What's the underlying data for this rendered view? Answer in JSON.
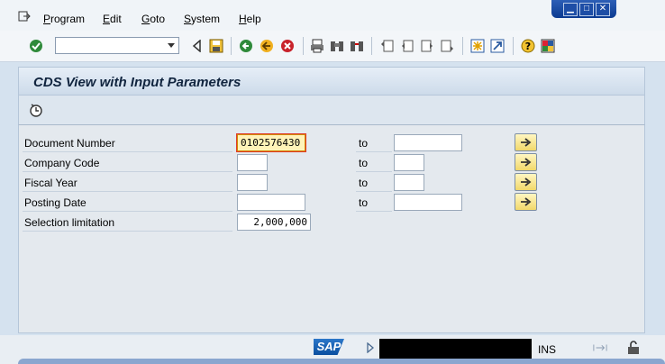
{
  "menu": {
    "items": [
      "Program",
      "Edit",
      "Goto",
      "System",
      "Help"
    ]
  },
  "toolbar": {
    "command_field_value": ""
  },
  "screen": {
    "title": "CDS View with Input Parameters"
  },
  "form": {
    "rows": [
      {
        "label": "Document Number",
        "low": "0102576430",
        "to_label": "to",
        "high": ""
      },
      {
        "label": "Company Code",
        "low": "",
        "to_label": "to",
        "high": ""
      },
      {
        "label": "Fiscal Year",
        "low": "",
        "to_label": "to",
        "high": ""
      },
      {
        "label": "Posting Date",
        "low": "",
        "to_label": "to",
        "high": ""
      },
      {
        "label": "Selection limitation",
        "low": "2,000,000"
      }
    ]
  },
  "statusbar": {
    "logo": "SAP",
    "mode": "INS"
  },
  "colors": {
    "background": "#d5e2ef",
    "focus_field": "#fff3b8",
    "accent": "#0b3a91"
  },
  "icons": [
    "menu-icon",
    "enter-icon",
    "back-nav-icon",
    "save-icon",
    "back-icon",
    "exit-icon",
    "cancel-icon",
    "print-icon",
    "find-icon",
    "find-next-icon",
    "first-page-icon",
    "previous-page-icon",
    "next-page-icon",
    "last-page-icon",
    "create-session-icon",
    "shortcut-icon",
    "help-icon",
    "customize-layout-icon",
    "execute-icon",
    "multiple-selection-icon",
    "lock-icon"
  ]
}
